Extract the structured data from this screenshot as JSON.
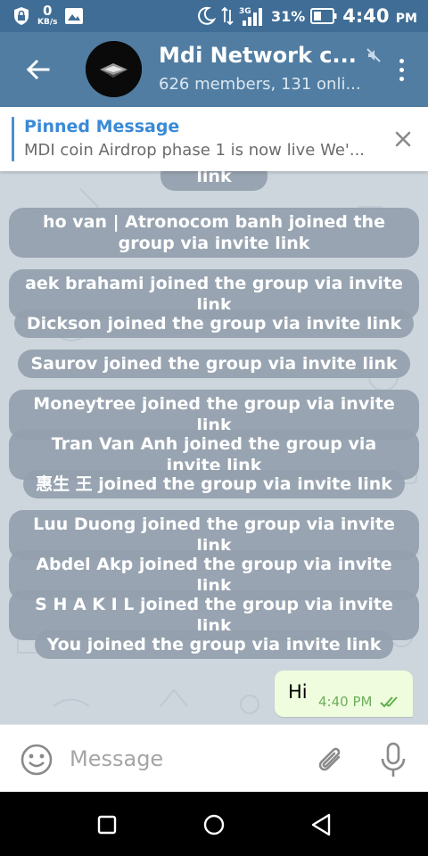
{
  "status_bar": {
    "net_speed": "0",
    "net_unit": "KB/s",
    "network_type": "3G",
    "battery_percent": "31%",
    "time": "4:40",
    "ampm": "PM"
  },
  "toolbar": {
    "title": "Mdi Network c...",
    "subtitle": "626 members, 131 onli..."
  },
  "pinned": {
    "title": "Pinned Message",
    "text": "MDI coin Airdrop phase 1 is now live We'..."
  },
  "service_messages": [
    "link",
    "ho van | Atronocom banh joined the group via invite link",
    "aek brahami joined the group via invite link",
    "Dickson joined the group via invite link",
    "Saurov joined the group via invite link",
    "Moneytree joined the group via invite link",
    "Tran Van Anh joined the group via invite link",
    "惠生 王 joined the group via invite link",
    "Luu Duong joined the group via invite link",
    "Abdel Akp joined the group via invite link",
    "S H A K I L joined the group via invite link",
    "You joined the group via invite link"
  ],
  "outgoing_message": {
    "text": "Hi",
    "time": "4:40 PM"
  },
  "input": {
    "placeholder": "Message"
  },
  "colors": {
    "toolbar": "#517da2",
    "status_bar": "#3f6d96",
    "chat_background": "#cdd5dd",
    "service_pill": "#94a0ac",
    "outgoing_bubble": "#effdde",
    "pinned_accent": "#3a8ad6"
  }
}
